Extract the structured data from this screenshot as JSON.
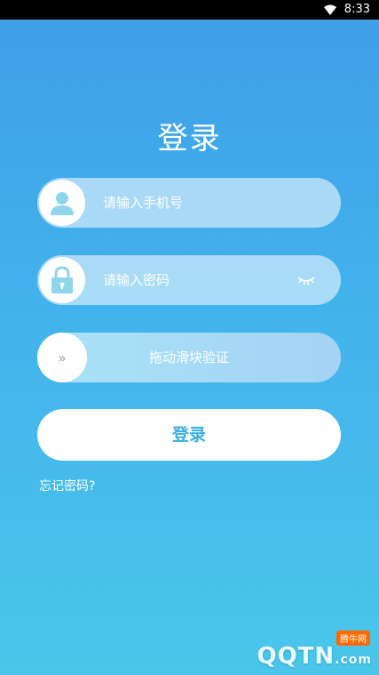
{
  "status_bar": {
    "time": "8:33"
  },
  "title": "登录",
  "phone_field": {
    "placeholder": "请输入手机号",
    "icon": "user-icon"
  },
  "password_field": {
    "placeholder": "请输入密码",
    "icon": "lock-icon",
    "toggle_icon": "eye-closed-icon"
  },
  "slider": {
    "label": "拖动滑块验证",
    "knob": "»"
  },
  "login_button": {
    "label": "登录"
  },
  "forgot_link": {
    "label": "忘记密码?"
  },
  "watermark": {
    "badge": "腾牛网",
    "logo_main": "QQTN",
    "logo_suffix": ".com"
  },
  "colors": {
    "accent": "#3aaee3",
    "bg_top": "#3f9ee7",
    "bg_bottom": "#4ac6ea"
  }
}
